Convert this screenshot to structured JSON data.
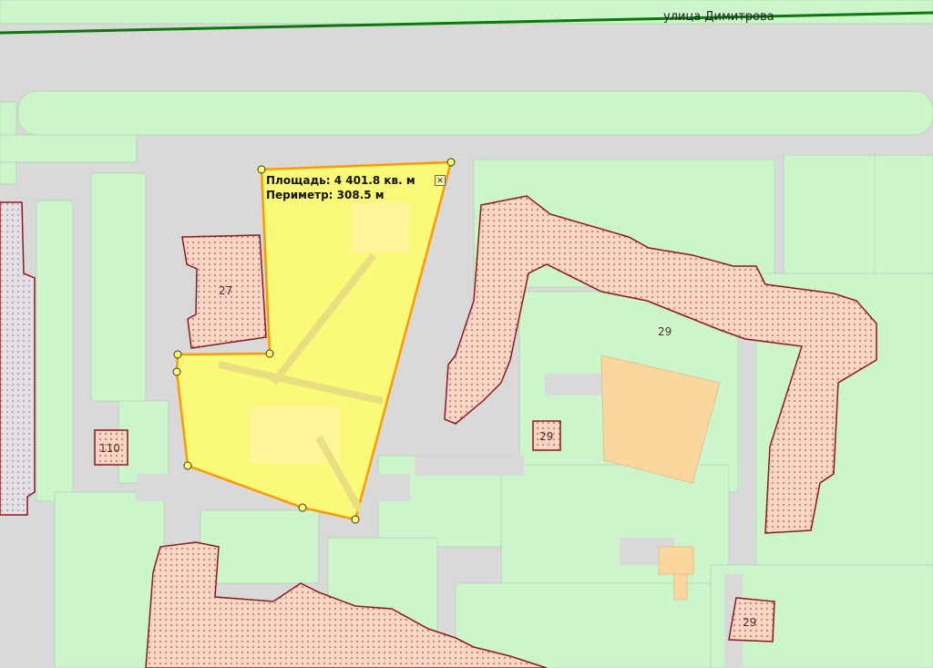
{
  "map": {
    "street_name": "улица Димитрова",
    "building_labels": {
      "b27": "27",
      "b29_main": "29",
      "b29_small": "29",
      "b29_bottom": "29",
      "b110": "110"
    }
  },
  "measurement": {
    "area_label": "Площадь:",
    "area_value": "4 401.8 кв. м",
    "perimeter_label": "Периметр:",
    "perimeter_value": "308.5 м"
  },
  "icons": {
    "close": "close-icon"
  },
  "colors": {
    "road": "#d9d9d9",
    "green_area": "#ccf5cc",
    "building_fill": "#f7d6c6",
    "building_border": "#8b1a1a",
    "measure_fill": "#ffff66",
    "measure_stroke": "#ff9900",
    "street_line": "#0b7a0b"
  }
}
